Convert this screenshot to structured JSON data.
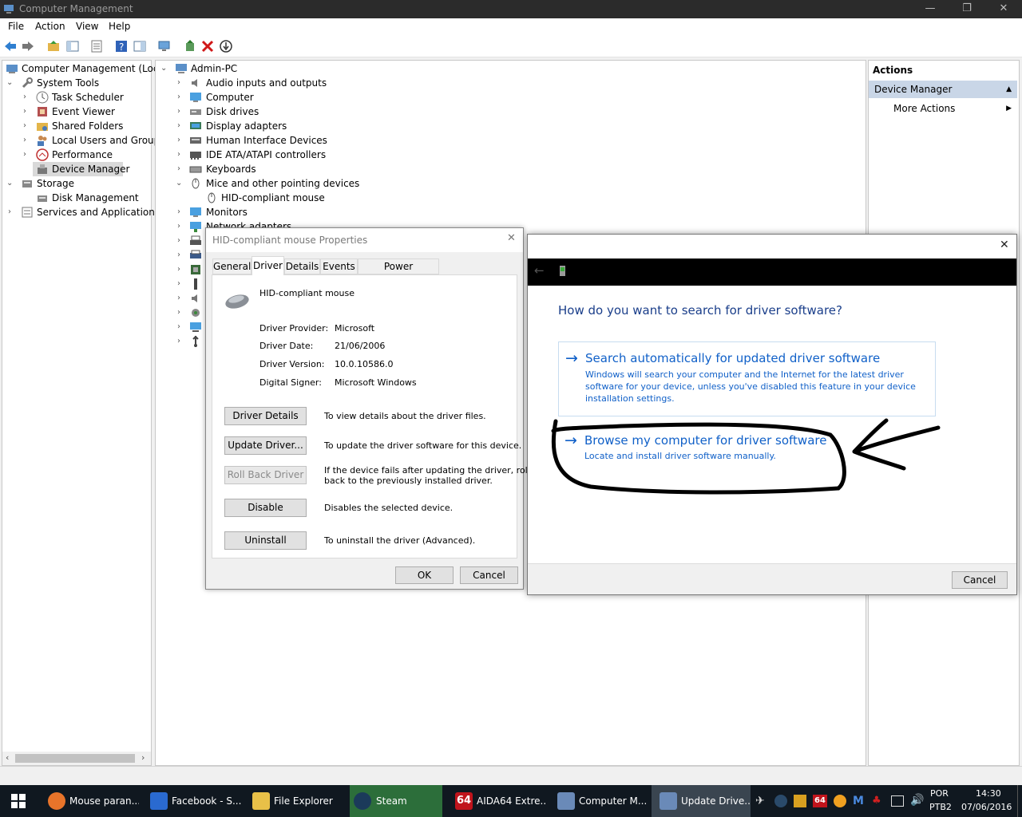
{
  "window": {
    "title": "Computer Management"
  },
  "menu": [
    "File",
    "Action",
    "View",
    "Help"
  ],
  "left_tree": {
    "root": "Computer Management (Local",
    "system_tools": "System Tools",
    "items": [
      "Task Scheduler",
      "Event Viewer",
      "Shared Folders",
      "Local Users and Groups",
      "Performance",
      "Device Manager"
    ],
    "storage": "Storage",
    "storage_items": [
      "Disk Management"
    ],
    "services": "Services and Applications"
  },
  "device_tree": {
    "root": "Admin-PC",
    "categories": [
      "Audio inputs and outputs",
      "Computer",
      "Disk drives",
      "Display adapters",
      "Human Interface Devices",
      "IDE ATA/ATAPI controllers",
      "Keyboards",
      "Mice and other pointing devices"
    ],
    "mouse_child": "HID-compliant mouse",
    "after": [
      "Monitors",
      "Network adapters"
    ]
  },
  "actions_pane": {
    "header": "Actions",
    "device_manager": "Device Manager",
    "more_actions": "More Actions"
  },
  "properties": {
    "title": "HID-compliant mouse Properties",
    "tabs": [
      "General",
      "Driver",
      "Details",
      "Events",
      "Power Management"
    ],
    "device_name": "HID-compliant mouse",
    "fields": [
      {
        "label": "Driver Provider:",
        "value": "Microsoft"
      },
      {
        "label": "Driver Date:",
        "value": "21/06/2006"
      },
      {
        "label": "Driver Version:",
        "value": "10.0.10586.0"
      },
      {
        "label": "Digital Signer:",
        "value": "Microsoft Windows"
      }
    ],
    "buttons": [
      {
        "label": "Driver Details",
        "desc": "To view details about the driver files."
      },
      {
        "label": "Update Driver...",
        "desc": "To update the driver software for this device."
      },
      {
        "label": "Roll Back Driver",
        "desc": "If the device fails after updating the driver, roll",
        "desc2": "back to the previously installed driver."
      },
      {
        "label": "Disable",
        "desc": "Disables the selected device."
      },
      {
        "label": "Uninstall",
        "desc": "To uninstall the driver (Advanced)."
      }
    ],
    "ok": "OK",
    "cancel": "Cancel"
  },
  "wizard": {
    "question": "How do you want to search for driver software?",
    "option1": {
      "title": "Search automatically for updated driver software",
      "desc": "Windows will search your computer and the Internet for the latest driver software for your device, unless you've disabled this feature in your device installation settings."
    },
    "option2": {
      "title": "Browse my computer for driver software",
      "desc": "Locate and install driver software manually."
    },
    "cancel": "Cancel"
  },
  "taskbar": {
    "tasks": [
      "Mouse paran...",
      "Facebook - S...",
      "File Explorer",
      "Steam",
      "AIDA64 Extre...",
      "Computer M...",
      "Update Drive..."
    ],
    "aida_badge": "64",
    "tray_badge": "64",
    "lang1": "POR",
    "lang2": "PTB2",
    "time": "14:30",
    "date": "07/06/2016"
  },
  "colors": {
    "accent": "#1060c8",
    "selection": "#c9d6e7",
    "taskbar": "#101820"
  }
}
